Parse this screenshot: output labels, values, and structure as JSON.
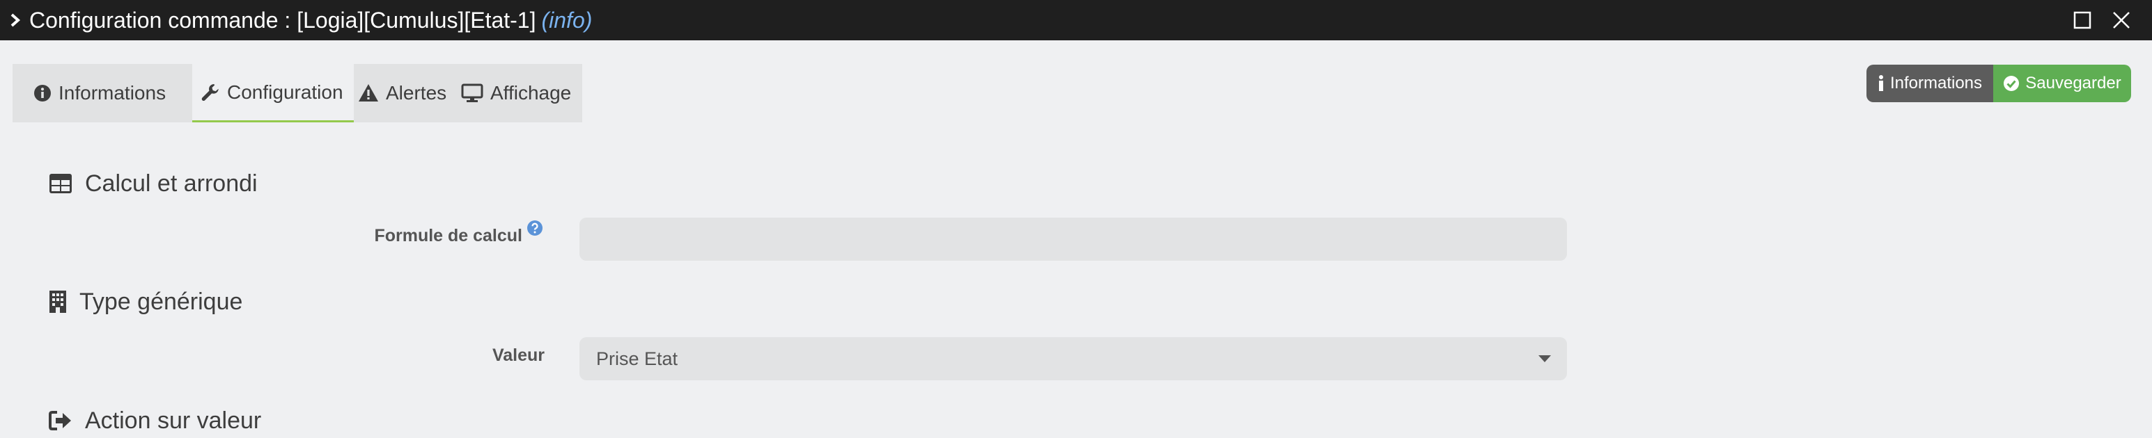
{
  "window": {
    "title": "Configuration commande : [Logia][Cumulus][Etat-1]",
    "title_suffix": "(info)"
  },
  "tabs": [
    {
      "label": "Informations",
      "icon": "info-circle-icon"
    },
    {
      "label": "Configuration",
      "icon": "wrench-icon",
      "active": true
    },
    {
      "label": "Alertes",
      "icon": "warning-icon"
    },
    {
      "label": "Affichage",
      "icon": "monitor-icon"
    }
  ],
  "actions": {
    "info_label": "Informations",
    "save_label": "Sauvegarder"
  },
  "sections": {
    "calcul": {
      "title": "Calcul et arrondi",
      "icon": "table-icon"
    },
    "type": {
      "title": "Type générique",
      "icon": "building-icon"
    },
    "action": {
      "title": "Action sur valeur",
      "icon": "sign-out-icon"
    }
  },
  "fields": {
    "formula": {
      "label": "Formule de calcul",
      "value": "",
      "placeholder": ""
    },
    "valeur": {
      "label": "Valeur",
      "selected": "Prise Etat"
    }
  },
  "colors": {
    "titlebar": "#1f1f1f",
    "info_accent": "#7bb3ef",
    "save_green": "#5fae53",
    "info_dark": "#5c5c5c",
    "tab_active_underline": "#94c94c"
  }
}
